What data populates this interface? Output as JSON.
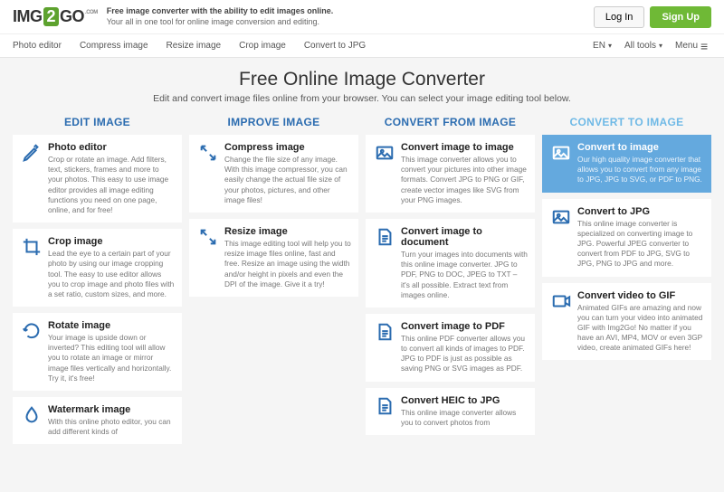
{
  "logo": {
    "p1": "IMG",
    "p2": "2",
    "p3": "GO",
    "p4": ".COM"
  },
  "tagline": {
    "l1": "Free image converter with the ability to edit images online.",
    "l2": "Your all in one tool for online image conversion and editing."
  },
  "auth": {
    "login": "Log In",
    "signup": "Sign Up"
  },
  "nav": {
    "items": [
      "Photo editor",
      "Compress image",
      "Resize image",
      "Crop image",
      "Convert to JPG"
    ],
    "lang": "EN",
    "alltools": "All tools",
    "menu": "Menu"
  },
  "hero": {
    "title": "Free Online Image Converter",
    "sub": "Edit and convert image files online from your browser. You can select your image editing tool below."
  },
  "colheads": [
    "EDIT IMAGE",
    "IMPROVE IMAGE",
    "CONVERT FROM IMAGE",
    "CONVERT TO IMAGE"
  ],
  "cols": [
    [
      {
        "t": "Photo editor",
        "d": "Crop or rotate an image. Add filters, text, stickers, frames and more to your photos. This easy to use image editor provides all image editing functions you need on one page, online, and for free!",
        "i": "pencil"
      },
      {
        "t": "Crop image",
        "d": "Lead the eye to a certain part of your photo by using our image cropping tool. The easy to use editor allows you to crop image and photo files with a set ratio, custom sizes, and more.",
        "i": "crop"
      },
      {
        "t": "Rotate image",
        "d": "Your image is upside down or inverted? This editing tool will allow you to rotate an image or mirror image files vertically and horizontally. Try it, it's free!",
        "i": "rotate"
      },
      {
        "t": "Watermark image",
        "d": "With this online photo editor, you can add different kinds of",
        "i": "drop"
      }
    ],
    [
      {
        "t": "Compress image",
        "d": "Change the file size of any image. With this image compressor, you can easily change the actual file size of your photos, pictures, and other image files!",
        "i": "compress"
      },
      {
        "t": "Resize image",
        "d": "This image editing tool will help you to resize image files online, fast and free. Resize an image using the width and/or height in pixels and even the DPI of the image. Give it a try!",
        "i": "resize"
      }
    ],
    [
      {
        "t": "Convert image to image",
        "d": "This image converter allows you to convert your pictures into other image formats. Convert JPG to PNG or GIF, create vector images like SVG from your PNG images.",
        "i": "image"
      },
      {
        "t": "Convert image to document",
        "d": "Turn your images into documents with this online image converter. JPG to PDF, PNG to DOC, JPEG to TXT – it's all possible. Extract text from images online.",
        "i": "doc"
      },
      {
        "t": "Convert image to PDF",
        "d": "This online PDF converter allows you to convert all kinds of images to PDF. JPG to PDF is just as possible as saving PNG or SVG images as PDF.",
        "i": "doc"
      },
      {
        "t": "Convert HEIC to JPG",
        "d": "This online image converter allows you to convert photos from",
        "i": "doc"
      }
    ],
    [
      {
        "t": "Convert to image",
        "d": "Our high quality image converter that allows you to convert from any image to JPG, JPG to SVG, or PDF to PNG.",
        "i": "image",
        "hl": true
      },
      {
        "t": "Convert to JPG",
        "d": "This online image converter is specialized on converting image to JPG. Powerful JPEG converter to convert from PDF to JPG, SVG to JPG, PNG to JPG and more.",
        "i": "image"
      },
      {
        "t": "Convert video to GIF",
        "d": "Animated GIFs are amazing and now you can turn your video into animated GIF with Img2Go! No matter if you have an AVI, MP4, MOV or even 3GP video, create animated GIFs here!",
        "i": "video"
      }
    ]
  ]
}
